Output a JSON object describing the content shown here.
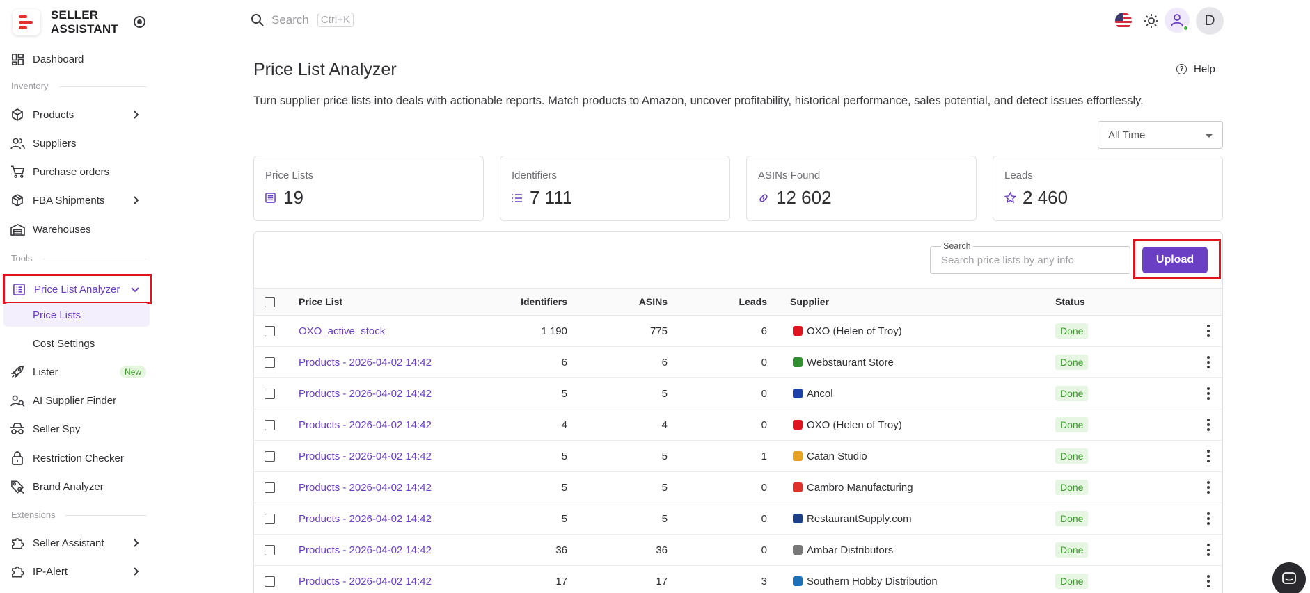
{
  "brand": {
    "line1": "SELLER",
    "line2": "ASSISTANT"
  },
  "sidebar": {
    "dashboard": "Dashboard",
    "section_inventory": "Inventory",
    "products": "Products",
    "suppliers": "Suppliers",
    "purchase_orders": "Purchase orders",
    "fba_shipments": "FBA Shipments",
    "warehouses": "Warehouses",
    "section_tools": "Tools",
    "price_list_analyzer": "Price List Analyzer",
    "price_lists": "Price Lists",
    "cost_settings": "Cost Settings",
    "lister": "Lister",
    "lister_badge": "New",
    "ai_supplier_finder": "AI Supplier Finder",
    "seller_spy": "Seller Spy",
    "restriction_checker": "Restriction Checker",
    "brand_analyzer": "Brand Analyzer",
    "section_extensions": "Extensions",
    "seller_assistant": "Seller Assistant",
    "ip_alert": "IP-Alert"
  },
  "topbar": {
    "search_placeholder": "Search",
    "shortcut": "Ctrl+K",
    "avatar_letter": "D"
  },
  "header": {
    "title": "Price List Analyzer",
    "help": "Help",
    "subtitle": "Turn supplier price lists into deals with actionable reports. Match products to Amazon, uncover profitability, historical performance, sales potential, and detect issues effortlessly.",
    "time_filter": "All Time"
  },
  "stats": [
    {
      "label": "Price Lists",
      "value": "19"
    },
    {
      "label": "Identifiers",
      "value": "7 111"
    },
    {
      "label": "ASINs Found",
      "value": "12 602"
    },
    {
      "label": "Leads",
      "value": "2 460"
    }
  ],
  "table": {
    "search_label": "Search",
    "search_placeholder": "Search price lists by any info",
    "upload_label": "Upload",
    "columns": {
      "price_list": "Price List",
      "identifiers": "Identifiers",
      "asins": "ASINs",
      "leads": "Leads",
      "supplier": "Supplier",
      "status": "Status"
    },
    "rows": [
      {
        "name": "OXO_active_stock",
        "identifiers": "1 190",
        "asins": "775",
        "leads": "6",
        "supplier": "OXO (Helen of Troy)",
        "status": "Done",
        "logo_color": "#e0141e"
      },
      {
        "name": "Products - 2026-04-02 14:42",
        "identifiers": "6",
        "asins": "6",
        "leads": "0",
        "supplier": "Webstaurant Store",
        "status": "Done",
        "logo_color": "#2f8f2f"
      },
      {
        "name": "Products - 2026-04-02 14:42",
        "identifiers": "5",
        "asins": "5",
        "leads": "0",
        "supplier": "Ancol",
        "status": "Done",
        "logo_color": "#1d3fa8"
      },
      {
        "name": "Products - 2026-04-02 14:42",
        "identifiers": "4",
        "asins": "4",
        "leads": "0",
        "supplier": "OXO (Helen of Troy)",
        "status": "Done",
        "logo_color": "#e0141e"
      },
      {
        "name": "Products - 2026-04-02 14:42",
        "identifiers": "5",
        "asins": "5",
        "leads": "1",
        "supplier": "Catan Studio",
        "status": "Done",
        "logo_color": "#e8a020"
      },
      {
        "name": "Products - 2026-04-02 14:42",
        "identifiers": "5",
        "asins": "5",
        "leads": "0",
        "supplier": "Cambro Manufacturing",
        "status": "Done",
        "logo_color": "#e0302a"
      },
      {
        "name": "Products - 2026-04-02 14:42",
        "identifiers": "5",
        "asins": "5",
        "leads": "0",
        "supplier": "RestaurantSupply.com",
        "status": "Done",
        "logo_color": "#1d3f8a"
      },
      {
        "name": "Products - 2026-04-02 14:42",
        "identifiers": "36",
        "asins": "36",
        "leads": "0",
        "supplier": "Ambar Distributors",
        "status": "Done",
        "logo_color": "#777777"
      },
      {
        "name": "Products - 2026-04-02 14:42",
        "identifiers": "17",
        "asins": "17",
        "leads": "3",
        "supplier": "Southern Hobby Distribution",
        "status": "Done",
        "logo_color": "#1d6fb8"
      }
    ]
  },
  "colors": {
    "accent": "#6a3fc4",
    "highlight_box": "#e0141e",
    "status_done_bg": "#e6f6e2"
  }
}
